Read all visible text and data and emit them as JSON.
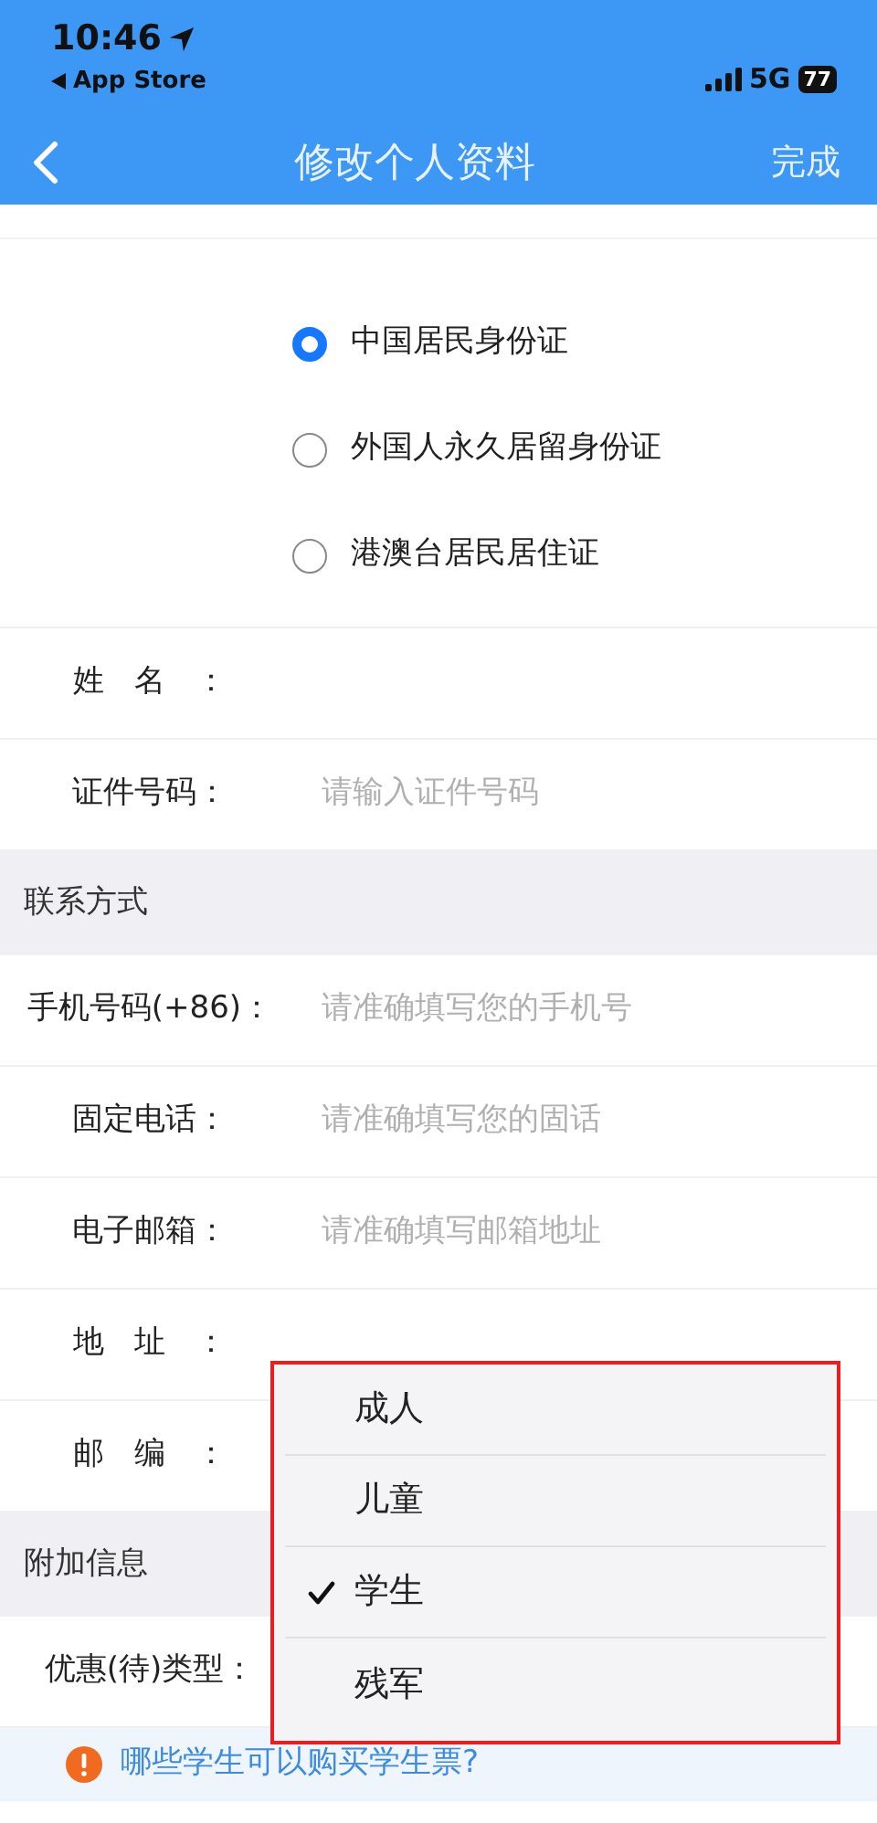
{
  "status_bar": {
    "time": "10:46",
    "back_app": "App Store",
    "network": "5G",
    "battery": "77"
  },
  "nav": {
    "title": "修改个人资料",
    "action": "完成"
  },
  "id_types": [
    {
      "label": "中国居民身份证",
      "selected": true
    },
    {
      "label": "外国人永久居留身份证",
      "selected": false
    },
    {
      "label": "港澳台居民居住证",
      "selected": false
    }
  ],
  "identity_fields": [
    {
      "label": "姓名：",
      "justify": true
    },
    {
      "label": "证件号码：",
      "placeholder": "请输入证件号码"
    }
  ],
  "contact_section": {
    "title": "联系方式",
    "fields": [
      {
        "label": "手机号码(+86)：",
        "placeholder": "请准确填写您的手机号"
      },
      {
        "label": "固定电话：",
        "placeholder": "请准确填写您的固话"
      },
      {
        "label": "电子邮箱：",
        "placeholder": "请准确填写邮箱地址"
      },
      {
        "label": "地址：",
        "justify": true
      },
      {
        "label": "邮编：",
        "justify": true
      }
    ]
  },
  "extra_section": {
    "title": "附加信息",
    "fields": [
      {
        "label": "优惠(待)类型："
      }
    ]
  },
  "tip": {
    "text": "哪些学生可以购买学生票?"
  },
  "passenger_type_menu": [
    {
      "label": "成人",
      "selected": false
    },
    {
      "label": "儿童",
      "selected": false
    },
    {
      "label": "学生",
      "selected": true
    },
    {
      "label": "残军",
      "selected": false
    }
  ]
}
